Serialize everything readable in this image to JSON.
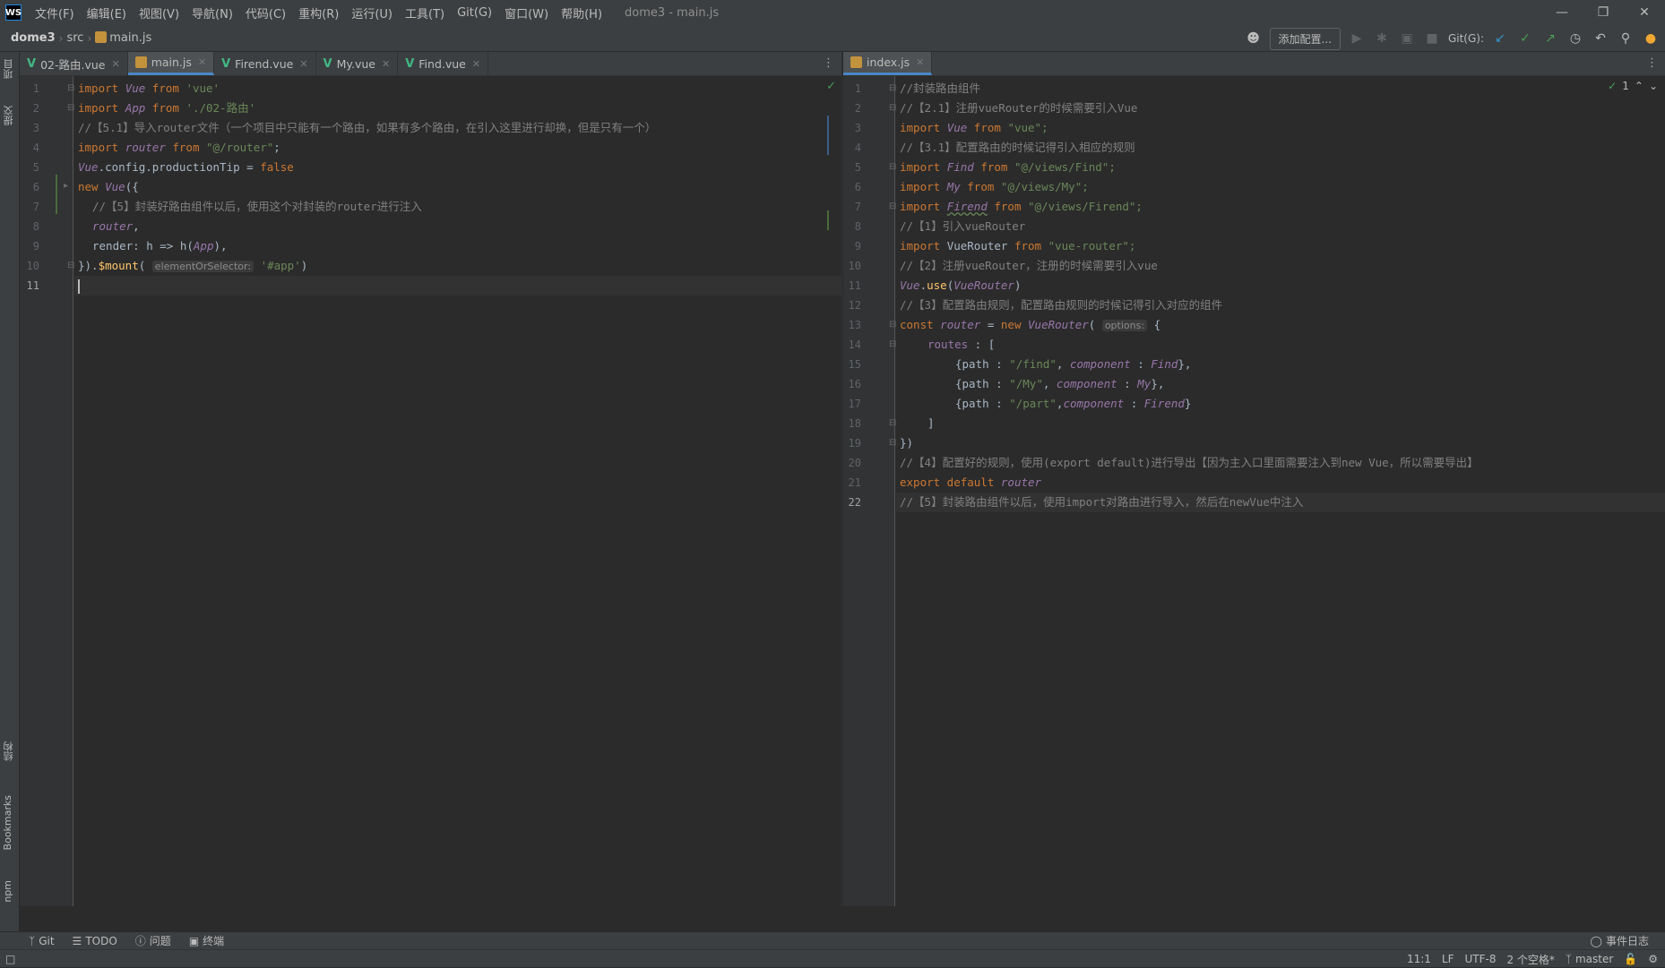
{
  "menubar": {
    "logo": "WS",
    "items": [
      "文件(F)",
      "编辑(E)",
      "视图(V)",
      "导航(N)",
      "代码(C)",
      "重构(R)",
      "运行(U)",
      "工具(T)",
      "Git(G)",
      "窗口(W)",
      "帮助(H)"
    ],
    "title": "dome3 - main.js"
  },
  "navbar": {
    "project": "dome3",
    "folder": "src",
    "file": "main.js",
    "add_config": "添加配置...",
    "git_label": "Git(G):"
  },
  "left_strip": {
    "project": "项目",
    "commit": "提交",
    "structure": "结构",
    "bookmarks": "Bookmarks",
    "npm": "npm"
  },
  "left_pane": {
    "tabs": [
      {
        "label": "02-路由.vue",
        "type": "vue"
      },
      {
        "label": "main.js",
        "type": "js"
      },
      {
        "label": "Firend.vue",
        "type": "vue"
      },
      {
        "label": "My.vue",
        "type": "vue"
      },
      {
        "label": "Find.vue",
        "type": "vue"
      }
    ],
    "lines": [
      "1",
      "2",
      "3",
      "4",
      "5",
      "6",
      "7",
      "8",
      "9",
      "10",
      "11"
    ],
    "code": {
      "l1_kw": "import",
      "l1_cls": "Vue",
      "l1_from": "from",
      "l1_str": "'vue'",
      "l2_kw": "import",
      "l2_cls": "App",
      "l2_from": "from",
      "l2_str": "'./02-路由'",
      "l3": "//【5.1】导入router文件（一个项目中只能有一个路由，如果有多个路由，在引入这里进行却换，但是只有一个）",
      "l4_kw": "import",
      "l4_var": "router",
      "l4_from": "from",
      "l4_str": "\"@/router\"",
      "l5_cls": "Vue",
      "l5_rest": ".config.productionTip = ",
      "l5_val": "false",
      "l6_kw": "new",
      "l6_cls": "Vue",
      "l6_rest": "({",
      "l7": "//【5】封装好路由组件以后，使用这个对封装的router进行注入",
      "l8_var": "router",
      "l9_a": "render: h => h(",
      "l9_cls": "App",
      "l9_b": "),",
      "l10_a": "}).",
      "l10_fn": "$mount",
      "l10_hint": "elementOrSelector:",
      "l10_str": "'#app'",
      "l10_b": ")"
    }
  },
  "right_pane": {
    "tab": "index.js",
    "inspection": "1",
    "lines": [
      "1",
      "2",
      "3",
      "4",
      "5",
      "6",
      "7",
      "8",
      "9",
      "10",
      "11",
      "12",
      "13",
      "14",
      "15",
      "16",
      "17",
      "18",
      "19",
      "20",
      "21",
      "22"
    ],
    "code": {
      "l1": "//封装路由组件",
      "l2": "//【2.1】注册vueRouter的时候需要引入Vue",
      "l3_kw": "import",
      "l3_cls": "Vue",
      "l3_from": "from",
      "l3_str": "\"vue\";",
      "l4": "//【3.1】配置路由的时候记得引入相应的规则",
      "l5_kw": "import",
      "l5_cls": "Find",
      "l5_from": "from",
      "l5_str": "\"@/views/Find\";",
      "l6_kw": "import",
      "l6_cls": "My",
      "l6_from": "from",
      "l6_str": "\"@/views/My\";",
      "l7_kw": "import",
      "l7_cls": "Firend",
      "l7_from": "from",
      "l7_str": "\"@/views/Firend\";",
      "l8": "//【1】引入vueRouter",
      "l9_kw": "import",
      "l9_var": "VueRouter",
      "l9_from": "from",
      "l9_str": "\"vue-router\";",
      "l10": "//【2】注册vueRouter，注册的时候需要引入vue",
      "l11_cls": "Vue",
      "l11_a": ".",
      "l11_fn": "use",
      "l11_b": "(",
      "l11_cls2": "VueRouter",
      "l11_c": ")",
      "l12": "//【3】配置路由规则，配置路由规则的时候记得引入对应的组件",
      "l13_kw": "const",
      "l13_var": "router",
      "l13_eq": " = ",
      "l13_new": "new",
      "l13_cls": "VueRouter",
      "l13_hint": "options:",
      "l13_b": "{",
      "l14_prop": "routes",
      "l14_b": " : [",
      "l15_a": "{path : ",
      "l15_str": "\"/find\"",
      "l15_b": ", ",
      "l15_prop": "component",
      "l15_c": " : ",
      "l15_cls": "Find",
      "l15_d": "},",
      "l16_a": "{path : ",
      "l16_str": "\"/My\"",
      "l16_b": ", ",
      "l16_prop": "component",
      "l16_c": " : ",
      "l16_cls": "My",
      "l16_d": "},",
      "l17_a": "{path : ",
      "l17_str": "\"/part\"",
      "l17_b": ",",
      "l17_prop": "component",
      "l17_c": " : ",
      "l17_cls": "Firend",
      "l17_d": "}",
      "l18": "]",
      "l19": "})",
      "l20": "//【4】配置好的规则，使用(export default)进行导出【因为主入口里面需要注入到new Vue，所以需要导出】",
      "l21_kw": "export default",
      "l21_var": "router",
      "l22": "//【5】封装路由组件以后，使用import对路由进行导入，然后在newVue中注入"
    }
  },
  "tool_tabs": {
    "git": "Git",
    "todo": "TODO",
    "problems": "问题",
    "terminal": "终端",
    "event_log": "事件日志"
  },
  "status": {
    "position": "11:1",
    "line_sep": "LF",
    "encoding": "UTF-8",
    "indent": "2 个空格*",
    "branch": "master"
  },
  "colors": {
    "background": "#2b2b2b",
    "keyword": "#cc7832",
    "string": "#6a8759",
    "comment": "#808080",
    "class": "#9876aa",
    "function": "#ffc66d",
    "vue_green": "#41b883",
    "active_tab": "#4a88c7"
  }
}
